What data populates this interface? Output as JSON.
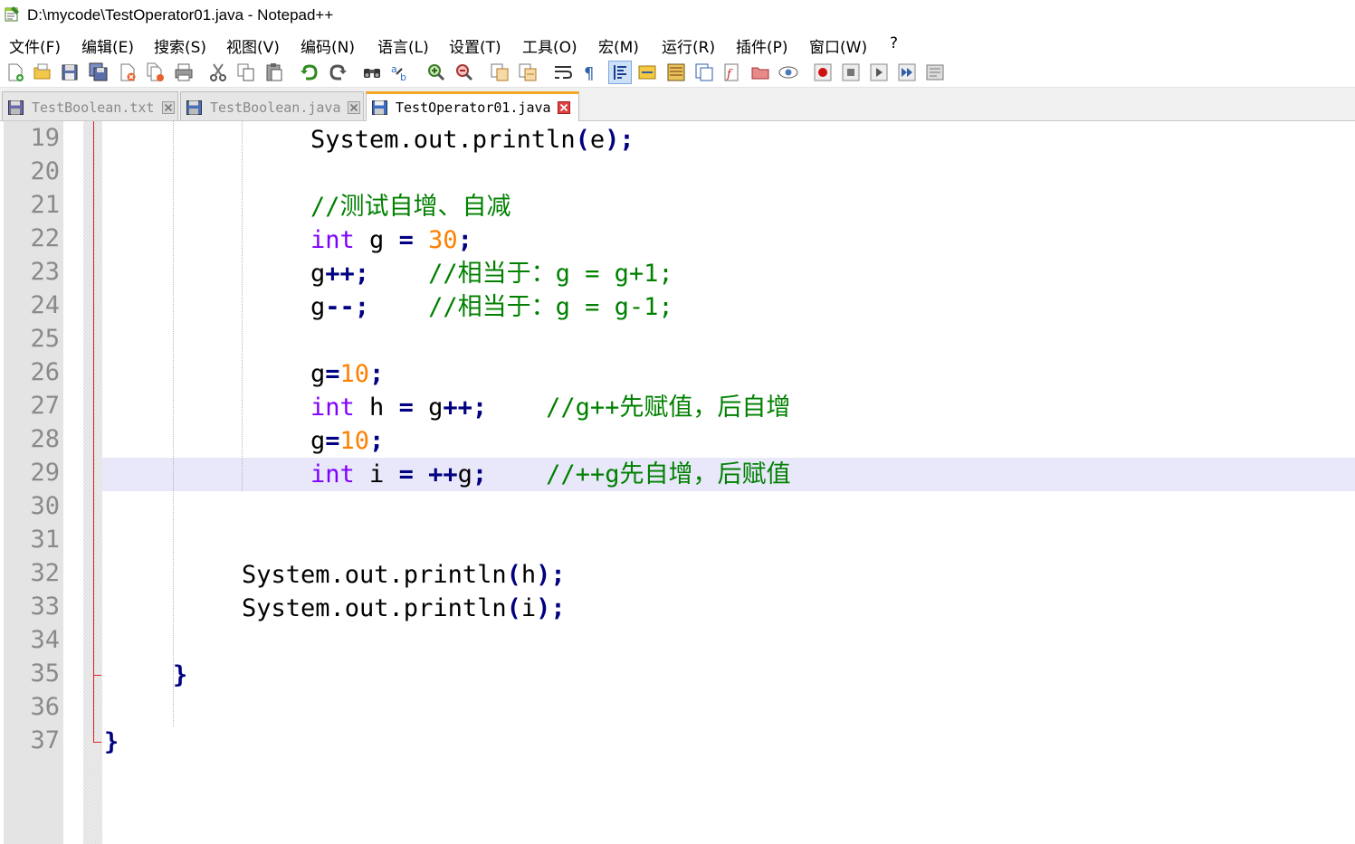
{
  "window": {
    "title": "D:\\mycode\\TestOperator01.java - Notepad++"
  },
  "menu": [
    "文件(F)",
    "编辑(E)",
    "搜索(S)",
    "视图(V)",
    "编码(N)",
    "语言(L)",
    "设置(T)",
    "工具(O)",
    "宏(M)",
    "运行(R)",
    "插件(P)",
    "窗口(W)",
    "?"
  ],
  "tabs": [
    {
      "label": "TestBoolean.txt",
      "active": false
    },
    {
      "label": "TestBoolean.java",
      "active": false
    },
    {
      "label": "TestOperator01.java",
      "active": true
    }
  ],
  "editor": {
    "current_line": 29,
    "line_numbers": [
      "19",
      "20",
      "21",
      "22",
      "23",
      "24",
      "25",
      "26",
      "27",
      "28",
      "29",
      "30",
      "31",
      "32",
      "33",
      "34",
      "35",
      "36",
      "37"
    ],
    "lines": {
      "l19": [
        "System.out.println",
        "(",
        "e",
        ")",
        ";"
      ],
      "l21": [
        "//测试自增、自减"
      ],
      "l22": [
        "int",
        " g ",
        "=",
        " ",
        "30",
        ";"
      ],
      "l23": [
        "g",
        "++;",
        "    ",
        "//相当于：g = g+1;"
      ],
      "l24": [
        "g",
        "--;",
        "    ",
        "//相当于：g = g-1;"
      ],
      "l26": [
        "g",
        "=",
        "10",
        ";"
      ],
      "l27": [
        "int",
        " h ",
        "=",
        " g",
        "++;",
        "    ",
        "//g++先赋值，后自增"
      ],
      "l28": [
        "g",
        "=",
        "10",
        ";"
      ],
      "l29": [
        "int",
        " i ",
        "=",
        " ",
        "++",
        "g",
        ";",
        "    ",
        "//++g先自增，后赋值"
      ],
      "l32": [
        "System.out.println",
        "(",
        "h",
        ")",
        ";"
      ],
      "l33": [
        "System.out.println",
        "(",
        "i",
        ")",
        ";"
      ],
      "l35": [
        "}"
      ],
      "l37": [
        "}"
      ]
    }
  },
  "colors": {
    "keyword": "#8000ff",
    "number": "#ff8000",
    "operator": "#000080",
    "comment": "#008000",
    "current_line": "#e8e8fa",
    "tab_accent": "#f5a623"
  }
}
